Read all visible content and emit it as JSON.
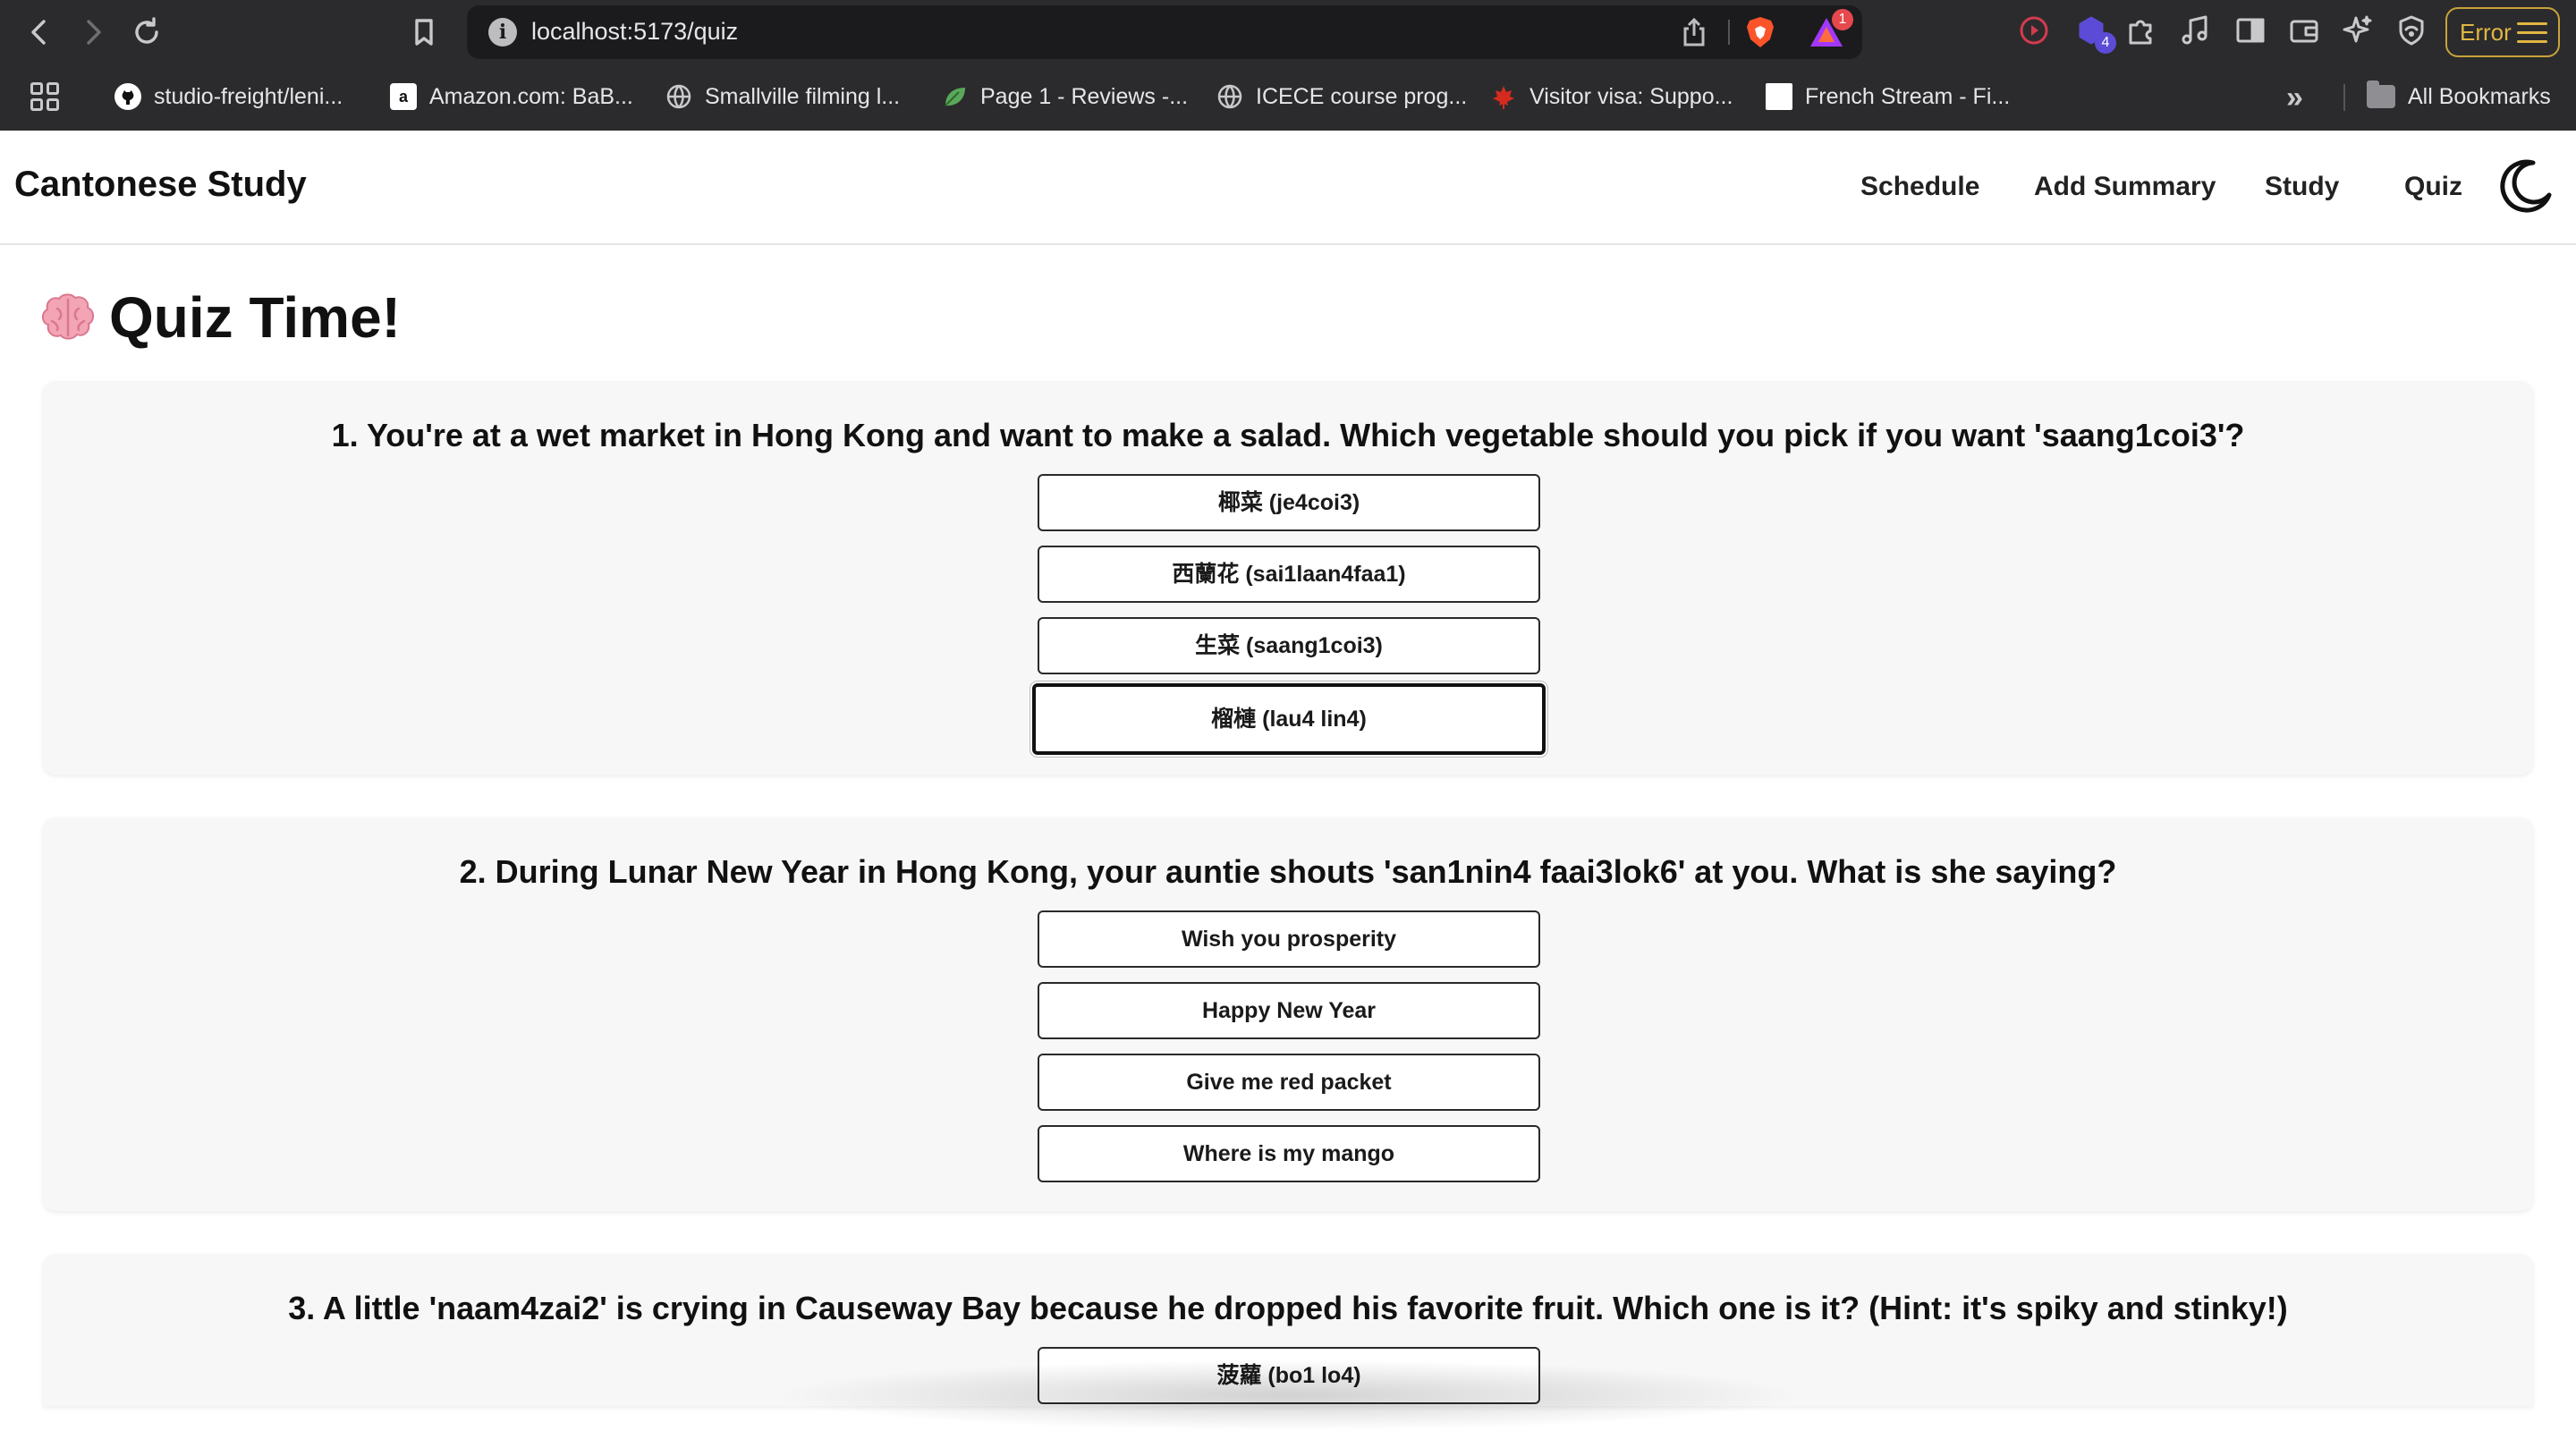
{
  "browser": {
    "url": "localhost:5173/quiz",
    "rewards_badge": "1",
    "extension_badge": "4",
    "error_label": "Error",
    "bookmarks": [
      {
        "label": "studio-freight/leni...",
        "icon": "github-icon"
      },
      {
        "label": "Amazon.com: BaB...",
        "icon": "amazon-icon"
      },
      {
        "label": "Smallville filming l...",
        "icon": "globe-icon"
      },
      {
        "label": "Page 1 - Reviews -...",
        "icon": "leaf-icon"
      },
      {
        "label": "ICECE course prog...",
        "icon": "globe-icon"
      },
      {
        "label": "Visitor visa: Suppo...",
        "icon": "maple-leaf-icon"
      },
      {
        "label": "French Stream - Fi...",
        "icon": "blank-page-icon"
      }
    ],
    "more_bookmarks": "»",
    "all_bookmarks": "All Bookmarks"
  },
  "app": {
    "brand": "Cantonese Study",
    "nav": [
      "Schedule",
      "Add Summary",
      "Study",
      "Quiz"
    ],
    "theme_toggle_icon": "moon-icon"
  },
  "page": {
    "title": "Quiz Time!",
    "title_icon": "brain-icon"
  },
  "questions": [
    {
      "text": "1. You're at a wet market in Hong Kong and want to make a salad. Which vegetable should you pick if you want 'saang1coi3'?",
      "options": [
        "椰菜 (je4coi3)",
        "西蘭花 (sai1laan4faa1)",
        "生菜 (saang1coi3)",
        "榴槤 (lau4 lin4)"
      ]
    },
    {
      "text": "2. During Lunar New Year in Hong Kong, your auntie shouts 'san1nin4 faai3lok6' at you. What is she saying?",
      "options": [
        "Wish you prosperity",
        "Happy New Year",
        "Give me red packet",
        "Where is my mango"
      ]
    },
    {
      "text": "3. A little 'naam4zai2' is crying in Causeway Bay because he dropped his favorite fruit. Which one is it? (Hint: it's spiky and stinky!)",
      "options": [
        "菠蘿 (bo1 lo4)"
      ]
    }
  ]
}
